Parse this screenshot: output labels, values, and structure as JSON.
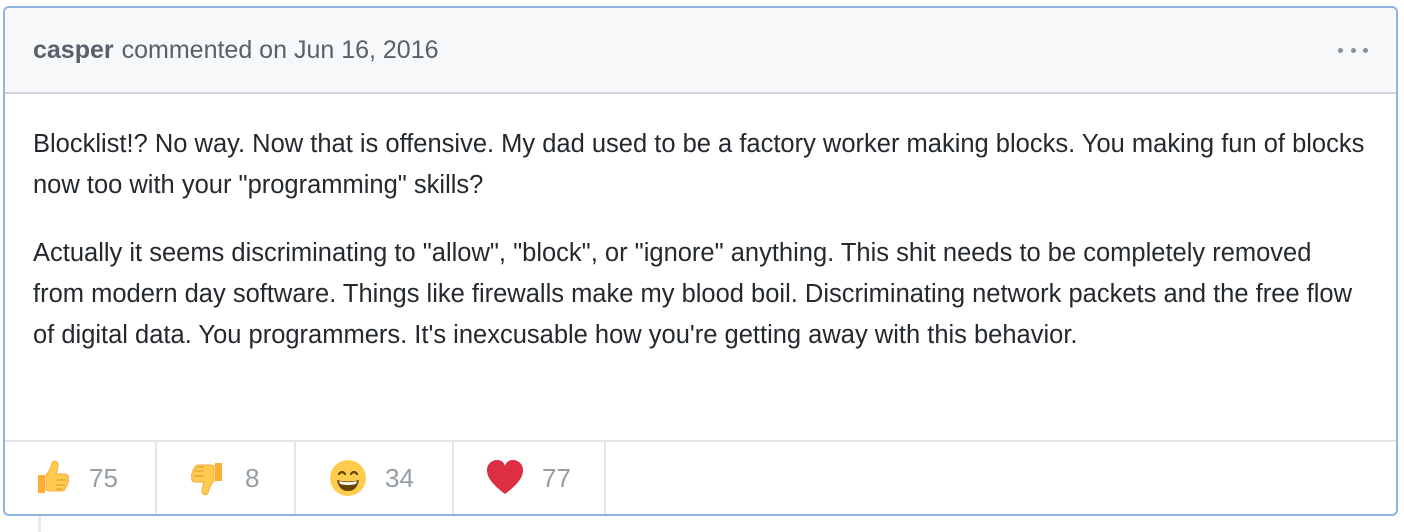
{
  "comment": {
    "author": "casper",
    "header_text": "commented on Jun 16, 2016",
    "menu_icon": "kebab-icon",
    "paragraphs": [
      "Blocklist!? No way. Now that is offensive. My dad used to be a factory worker making blocks. You making fun of blocks now too with your \"programming\" skills?",
      "Actually it seems discriminating to \"allow\", \"block\", or \"ignore\" anything. This shit needs to be completely removed from modern day software. Things like firewalls make my blood boil. Discriminating network packets and the free flow of digital data. You programmers. It's inexcusable how you're getting away with this behavior."
    ]
  },
  "reactions": [
    {
      "icon": "thumbs-up-icon",
      "count": "75"
    },
    {
      "icon": "thumbs-down-icon",
      "count": "8"
    },
    {
      "icon": "grinning-face-icon",
      "count": "34"
    },
    {
      "icon": "heart-icon",
      "count": "77"
    }
  ],
  "colors": {
    "border_accent": "#8fb3e3",
    "header_bg": "#f6f8fa",
    "muted_text": "#586069",
    "count_text": "#959da5",
    "heart": "#dd2e44",
    "emoji_yellow": "#ffcc4d"
  }
}
